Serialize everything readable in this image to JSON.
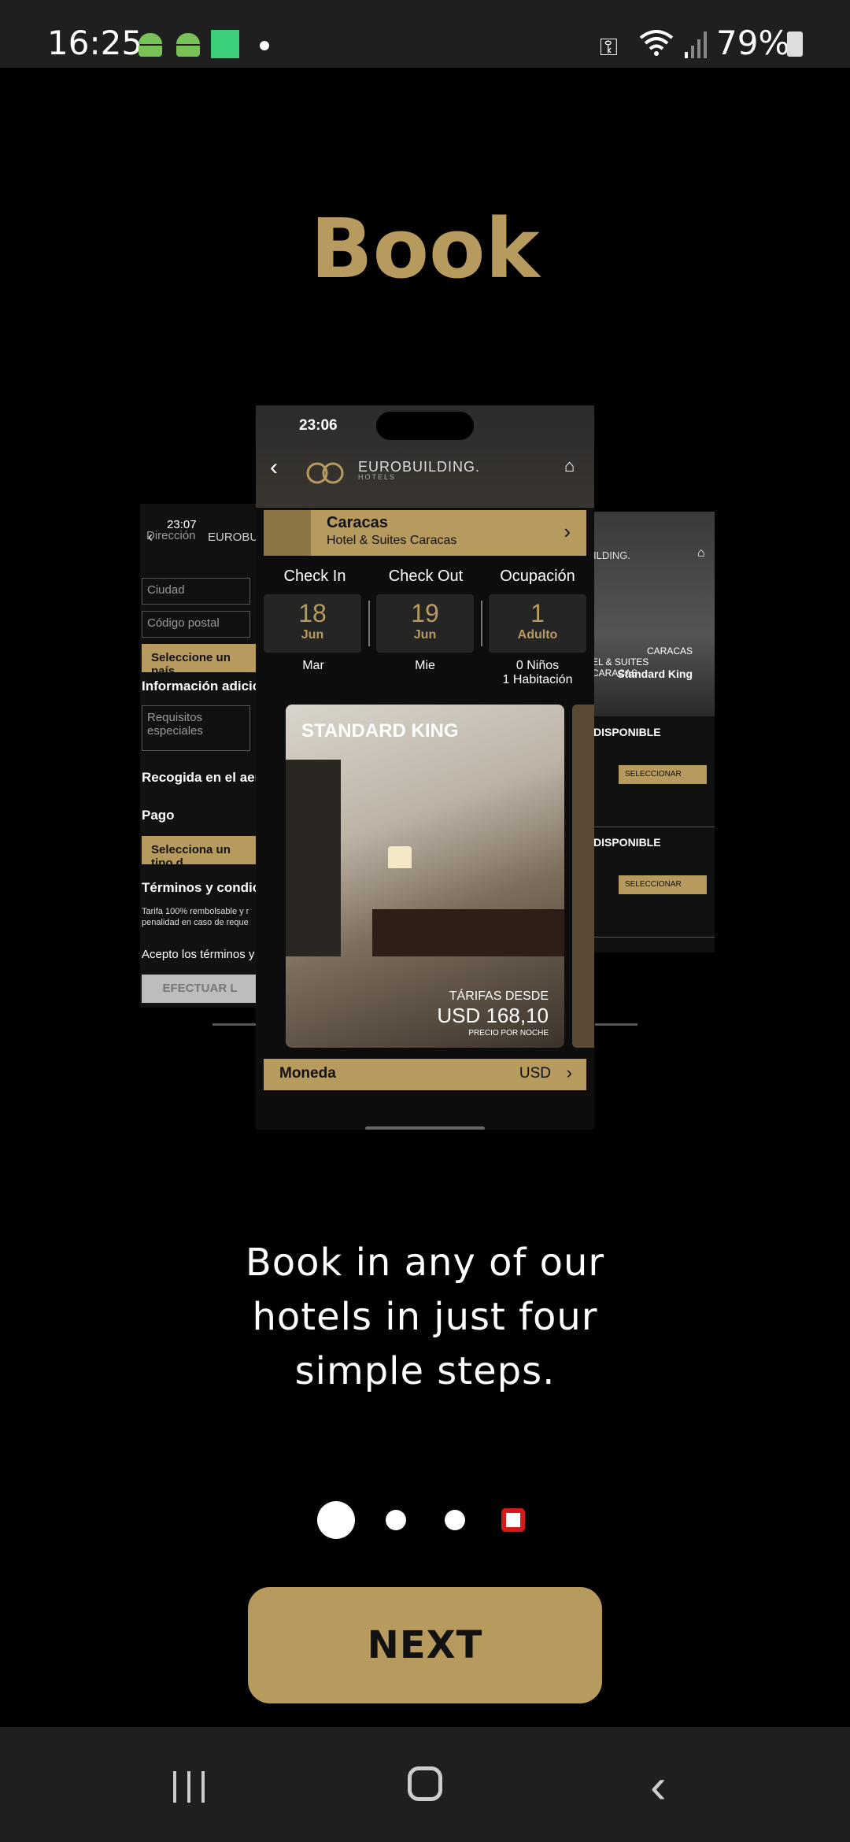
{
  "status_bar": {
    "time": "16:25",
    "battery": "79%",
    "icons": [
      "android-icon",
      "android-icon",
      "grid-icon",
      "dot-icon",
      "key-icon",
      "wifi-icon",
      "signal-icon",
      "battery-icon"
    ]
  },
  "title": "Book",
  "left_preview": {
    "time": "23:07",
    "logo": "EUROBU",
    "address_placeholder": "Dirección",
    "city_placeholder": "Ciudad",
    "postal_placeholder": "Código postal",
    "country_button": "Seleccione un país",
    "extra_info_heading": "Información adicio",
    "requests_placeholder": "Requisitos especiales",
    "airport_pickup": "Recogida en el aer",
    "payment_heading": "Pago",
    "payment_button": "Selecciona un tipo d",
    "terms_heading": "Términos y condic",
    "terms_text_1": "Tarifa 100% rembolsable y r",
    "terms_text_2": "penalidad en caso de reque",
    "accept_terms": "Acepto los términos y",
    "submit_button": "EFECTUAR L"
  },
  "right_preview": {
    "logo": "ILDING.",
    "city": "CARACAS",
    "hotel": "EL & SUITES CARACAS",
    "room": "Standard King",
    "available_1": "DISPONIBLE",
    "select_1": "SELECCIONAR",
    "available_2": "DISPONIBLE",
    "select_2": "SELECCIONAR"
  },
  "phone": {
    "time": "23:06",
    "logo": "EUROBUILDING.",
    "logo_sub": "HOTELS",
    "city": "Caracas",
    "hotel": "Hotel & Suites Caracas",
    "check_in": {
      "label": "Check In",
      "day": "18",
      "month": "Jun",
      "weekday": "Mar"
    },
    "check_out": {
      "label": "Check Out",
      "day": "19",
      "month": "Jun",
      "weekday": "Mie"
    },
    "occupancy": {
      "label": "Ocupación",
      "count": "1",
      "unit": "Adulto",
      "children": "0 Niños",
      "rooms": "1 Habitación"
    },
    "room": {
      "name": "STANDARD KING",
      "rate_label": "TÁRIFAS DESDE",
      "price": "USD 168,10",
      "price_note": "PRECIO POR NOCHE"
    },
    "currency": {
      "label": "Moneda",
      "value": "USD"
    }
  },
  "description": "Book in any of our hotels in just four simple steps.",
  "pager": {
    "total": 4,
    "active": 1
  },
  "next_button": "NEXT",
  "nav_bar": {
    "icons": [
      "recents-icon",
      "home-icon",
      "back-icon"
    ]
  },
  "colors": {
    "gold": "#b79a5e",
    "background": "#000000",
    "pager_focus": "#d41a1a"
  }
}
